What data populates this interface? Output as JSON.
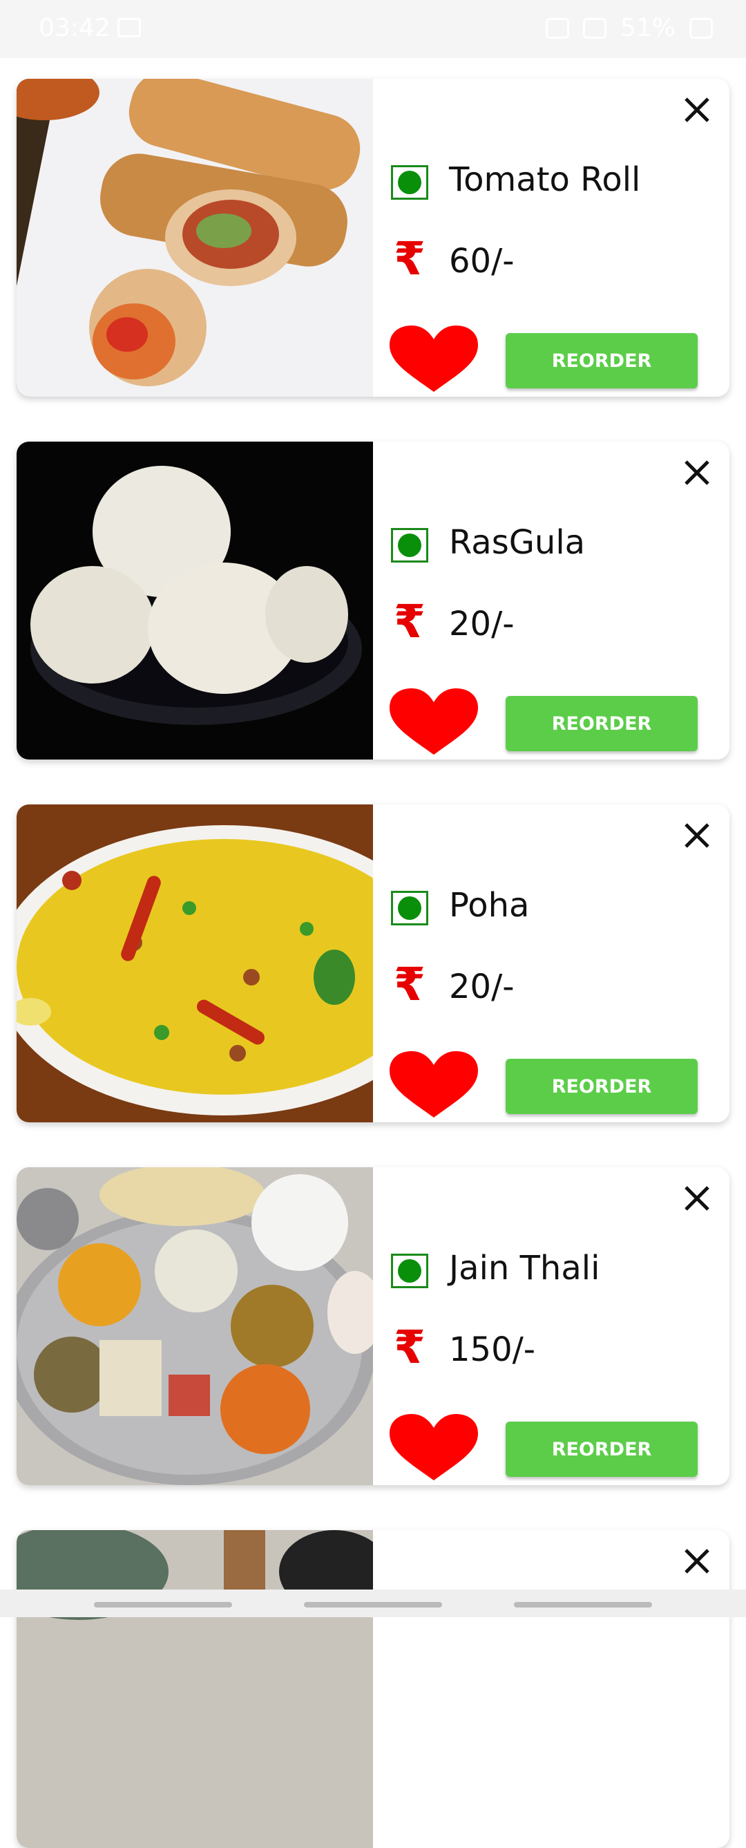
{
  "status_bar": {
    "time": "03:42",
    "battery": "51%"
  },
  "reorder_label": "REORDER",
  "rupee_symbol": "₹",
  "items": [
    {
      "name": "Tomato Roll",
      "price": "60/-",
      "image_icon": "spring-roll-photo"
    },
    {
      "name": "RasGula",
      "price": "20/-",
      "image_icon": "rasgulla-photo"
    },
    {
      "name": "Poha",
      "price": "20/-",
      "image_icon": "poha-photo"
    },
    {
      "name": "Jain Thali",
      "price": "150/-",
      "image_icon": "thali-photo"
    },
    {
      "name": "",
      "price": "",
      "image_icon": "food-photo"
    }
  ],
  "colors": {
    "veg_green": "#0a8f0a",
    "rupee_red": "#e60000",
    "heart_red": "#ff0000",
    "button_green": "#5ccd49"
  }
}
